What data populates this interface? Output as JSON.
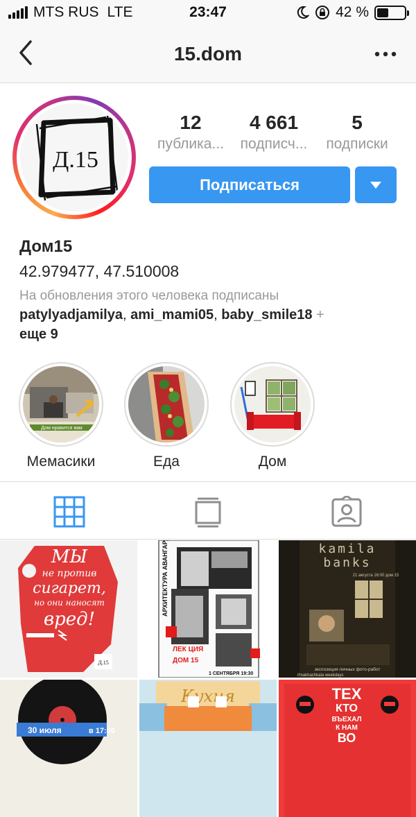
{
  "status_bar": {
    "carrier": "MTS RUS",
    "network": "LTE",
    "time": "23:47",
    "battery": "42 %",
    "battery_level": 0.42
  },
  "header": {
    "title": "15.dom"
  },
  "profile": {
    "avatar_text": "Д.15",
    "stats": [
      {
        "value": "12",
        "label": "публика..."
      },
      {
        "value": "4 661",
        "label": "подписч..."
      },
      {
        "value": "5",
        "label": "подписки"
      }
    ],
    "follow_label": "Подписаться"
  },
  "bio": {
    "name": "Дом15",
    "coords": "42.979477, 47.510008",
    "followed_by_label": "На обновления этого человека подписаны",
    "followers": [
      "patylyadjamilya",
      "ami_mami05",
      "baby_smile18"
    ],
    "more": "еще 9"
  },
  "highlights": [
    {
      "label": "Мемасики",
      "caption": "Дом нравится вам"
    },
    {
      "label": "Еда"
    },
    {
      "label": "Дом"
    }
  ],
  "posts": [
    {
      "lines": [
        "МЫ",
        "не против",
        "сигарет,",
        "но они наносят",
        "вред!"
      ],
      "logo": "Д.15"
    },
    {
      "side": "АРХИТЕКТУРА АВАНГАРДА",
      "lecture": "ЛЕК ЦИЯ",
      "dom": "ДОМ 15",
      "date": "1 СЕНТЯБРЯ 19:30"
    },
    {
      "title1": "kamila",
      "title2": "banks",
      "info": "21 августа 16:00 дом 15",
      "footer": "экспозиция личных фото-работ",
      "footer2": "//makhachkala weekdays"
    },
    {
      "date": "30 июля",
      "time": "в 17:00"
    },
    {
      "title": "Кухня"
    },
    {
      "lines": [
        "ТЕХ",
        "КТО",
        "ВЪЕХАЛ",
        "К НАМ",
        "ВО"
      ]
    }
  ],
  "colors": {
    "accent": "#3897f0",
    "poster_red": "#e03a3a"
  }
}
